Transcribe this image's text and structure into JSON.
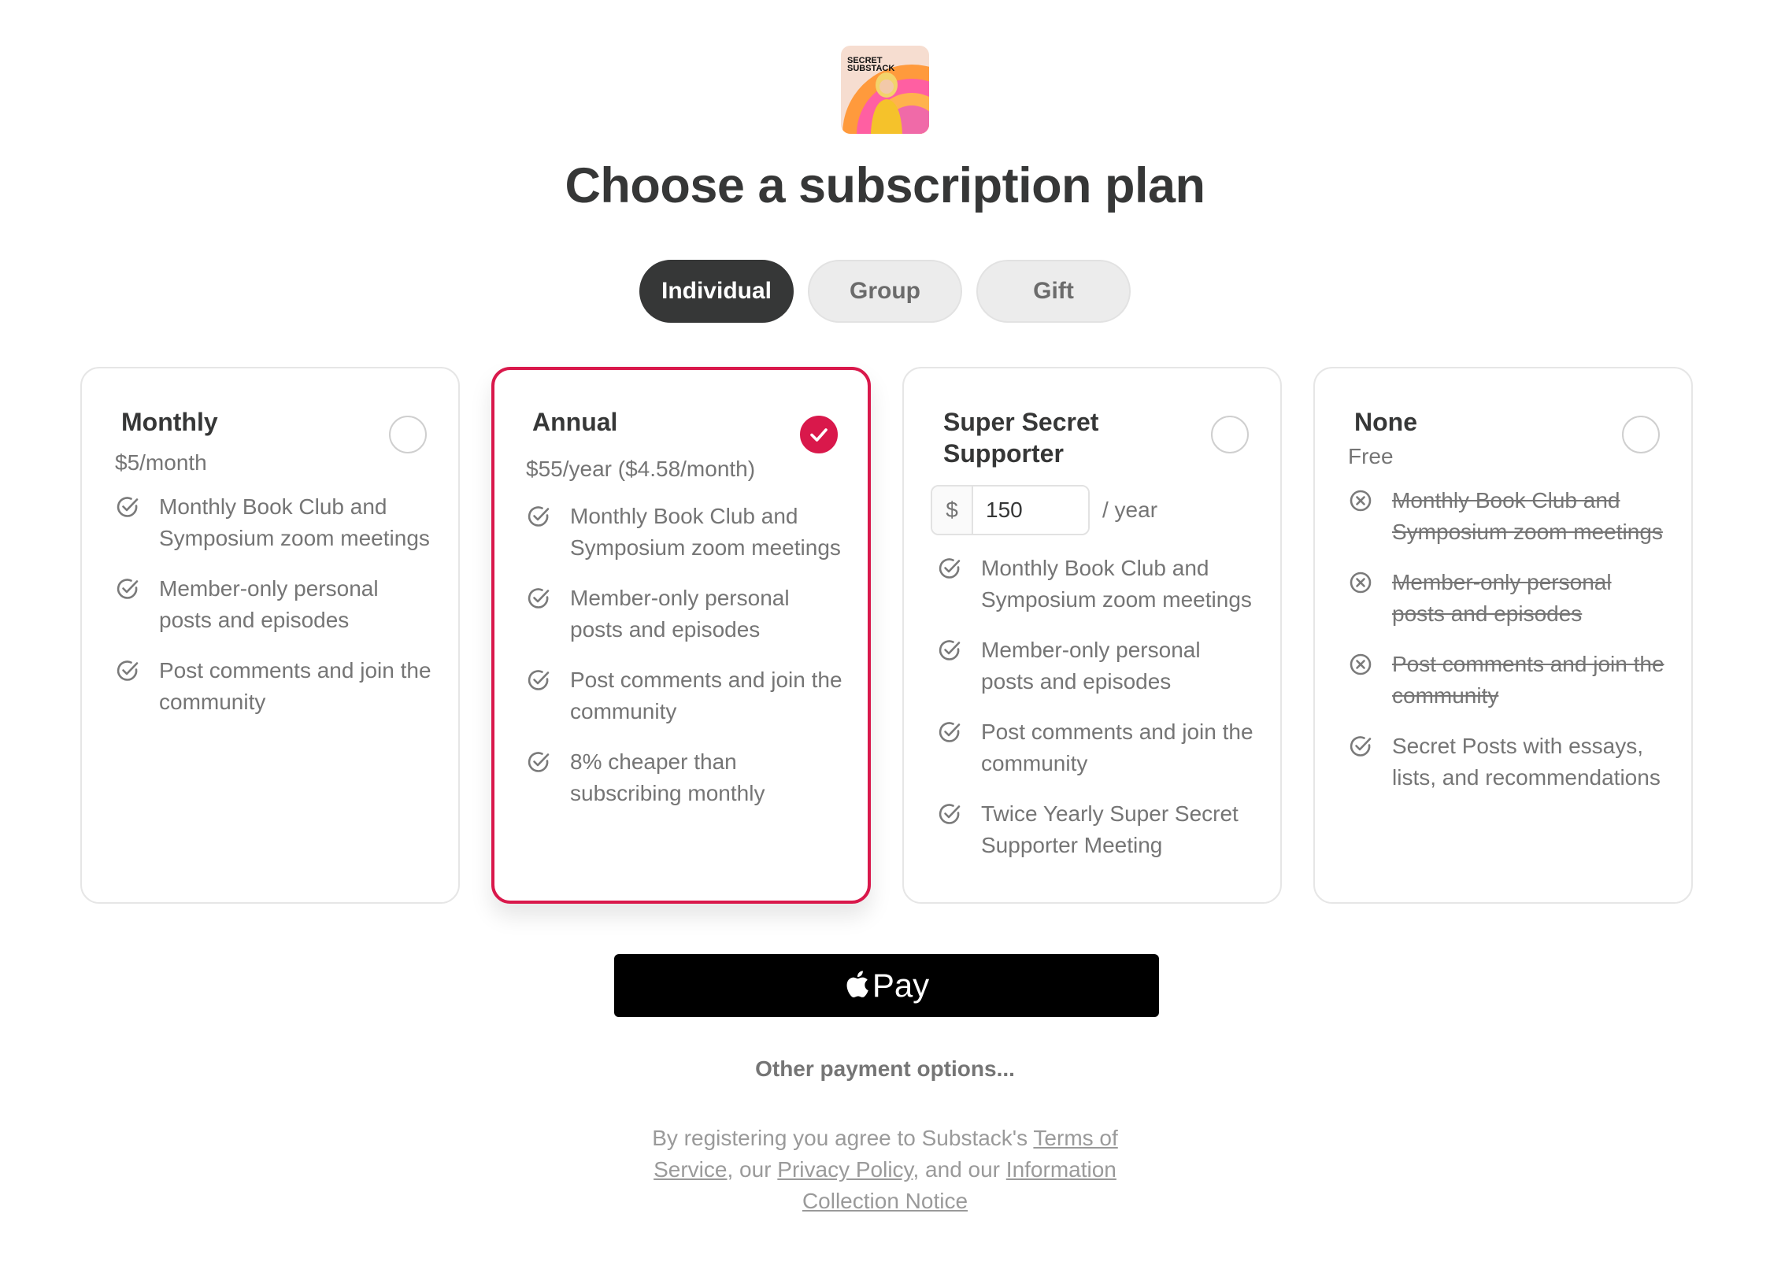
{
  "header": {
    "logo_alt": "Secret Substack",
    "logo_text_line1": "SECRET",
    "logo_text_line2": "SUBSTACK",
    "title": "Choose a subscription plan"
  },
  "tabs": [
    {
      "label": "Individual",
      "active": true
    },
    {
      "label": "Group",
      "active": false
    },
    {
      "label": "Gift",
      "active": false
    }
  ],
  "plans": [
    {
      "title": "Monthly",
      "price": "$5/month",
      "selected": false,
      "features": [
        {
          "text": "Monthly Book Club and Symposium zoom meetings",
          "included": true,
          "icon": "check-circle-icon"
        },
        {
          "text": "Member-only personal posts and episodes",
          "included": true,
          "icon": "check-circle-icon"
        },
        {
          "text": "Post comments and join the community",
          "included": true,
          "icon": "check-circle-icon"
        }
      ]
    },
    {
      "title": "Annual",
      "price": "$55/year ($4.58/month)",
      "selected": true,
      "features": [
        {
          "text": "Monthly Book Club and Symposium zoom meetings",
          "included": true,
          "icon": "check-circle-icon"
        },
        {
          "text": "Member-only personal posts and episodes",
          "included": true,
          "icon": "check-circle-icon"
        },
        {
          "text": "Post comments and join the community",
          "included": true,
          "icon": "check-circle-icon"
        },
        {
          "text": "8% cheaper than subscribing monthly",
          "included": true,
          "icon": "check-circle-icon"
        }
      ]
    },
    {
      "title": "Super Secret Supporter",
      "selected": false,
      "amount": {
        "prefix": "$",
        "value": "150",
        "suffix": "/ year"
      },
      "features": [
        {
          "text": "Monthly Book Club and Symposium zoom meetings",
          "included": true,
          "icon": "check-circle-icon"
        },
        {
          "text": "Member-only personal posts and episodes",
          "included": true,
          "icon": "check-circle-icon"
        },
        {
          "text": "Post comments and join the community",
          "included": true,
          "icon": "check-circle-icon"
        },
        {
          "text": "Twice Yearly Super Secret Supporter Meeting",
          "included": true,
          "icon": "check-circle-icon"
        }
      ]
    },
    {
      "title": "None",
      "price": "Free",
      "selected": false,
      "features": [
        {
          "text": "Monthly Book Club and Symposium zoom meetings",
          "included": false,
          "icon": "x-circle-icon"
        },
        {
          "text": "Member-only personal posts and episodes",
          "included": false,
          "icon": "x-circle-icon"
        },
        {
          "text": "Post comments and join the community",
          "included": false,
          "icon": "x-circle-icon"
        },
        {
          "text": "Secret Posts with essays, lists, and recommendations",
          "included": true,
          "icon": "check-circle-icon"
        }
      ]
    }
  ],
  "payment": {
    "apple_pay_label": "Pay",
    "other_options": "Other payment options..."
  },
  "legal": {
    "prefix": "By registering you agree to Substack's ",
    "terms": "Terms of Service",
    "sep1": ", our ",
    "privacy": "Privacy Policy",
    "sep2": ", and our ",
    "notice": "Information Collection Notice"
  },
  "colors": {
    "accent": "#d9184b",
    "text": "#363737",
    "muted": "#757575",
    "active_tab": "#363737"
  }
}
